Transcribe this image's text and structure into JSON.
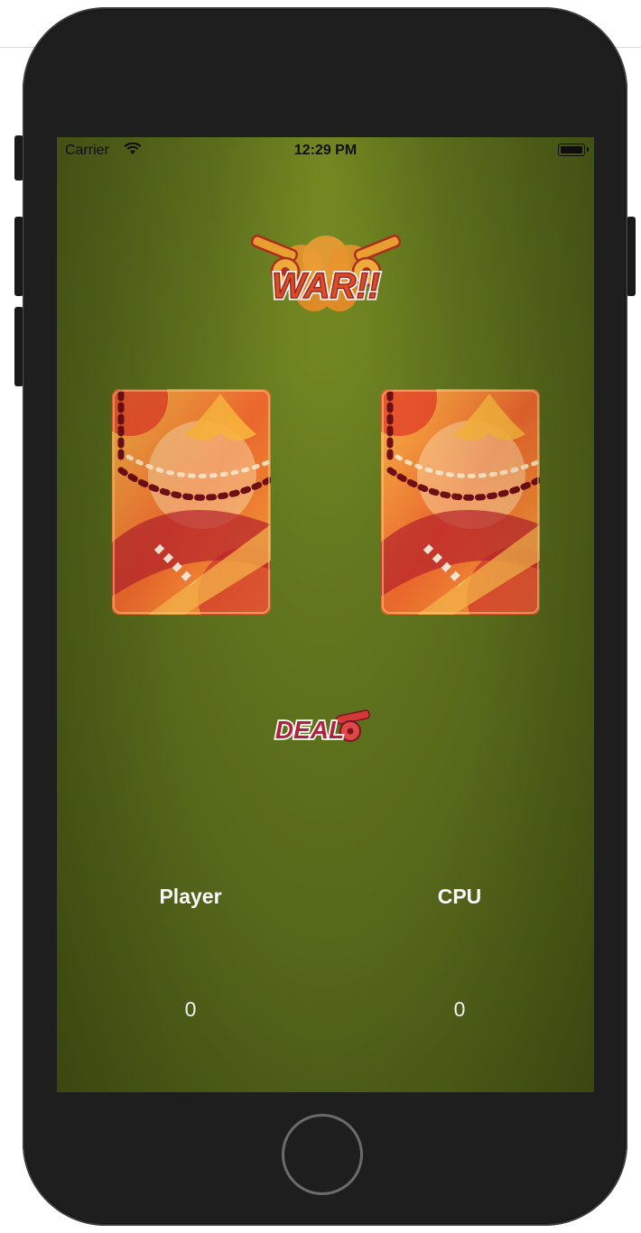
{
  "status_bar": {
    "carrier": "Carrier",
    "time": "12:29 PM"
  },
  "game": {
    "logo_text": "WAR!!",
    "deal_label": "DEAL",
    "player_label": "Player",
    "cpu_label": "CPU",
    "player_score": "0",
    "cpu_score": "0"
  },
  "colors": {
    "felt": "#64781f",
    "card_red": "#c0302a",
    "card_orange": "#f29a30",
    "deal_red": "#b0233a"
  }
}
